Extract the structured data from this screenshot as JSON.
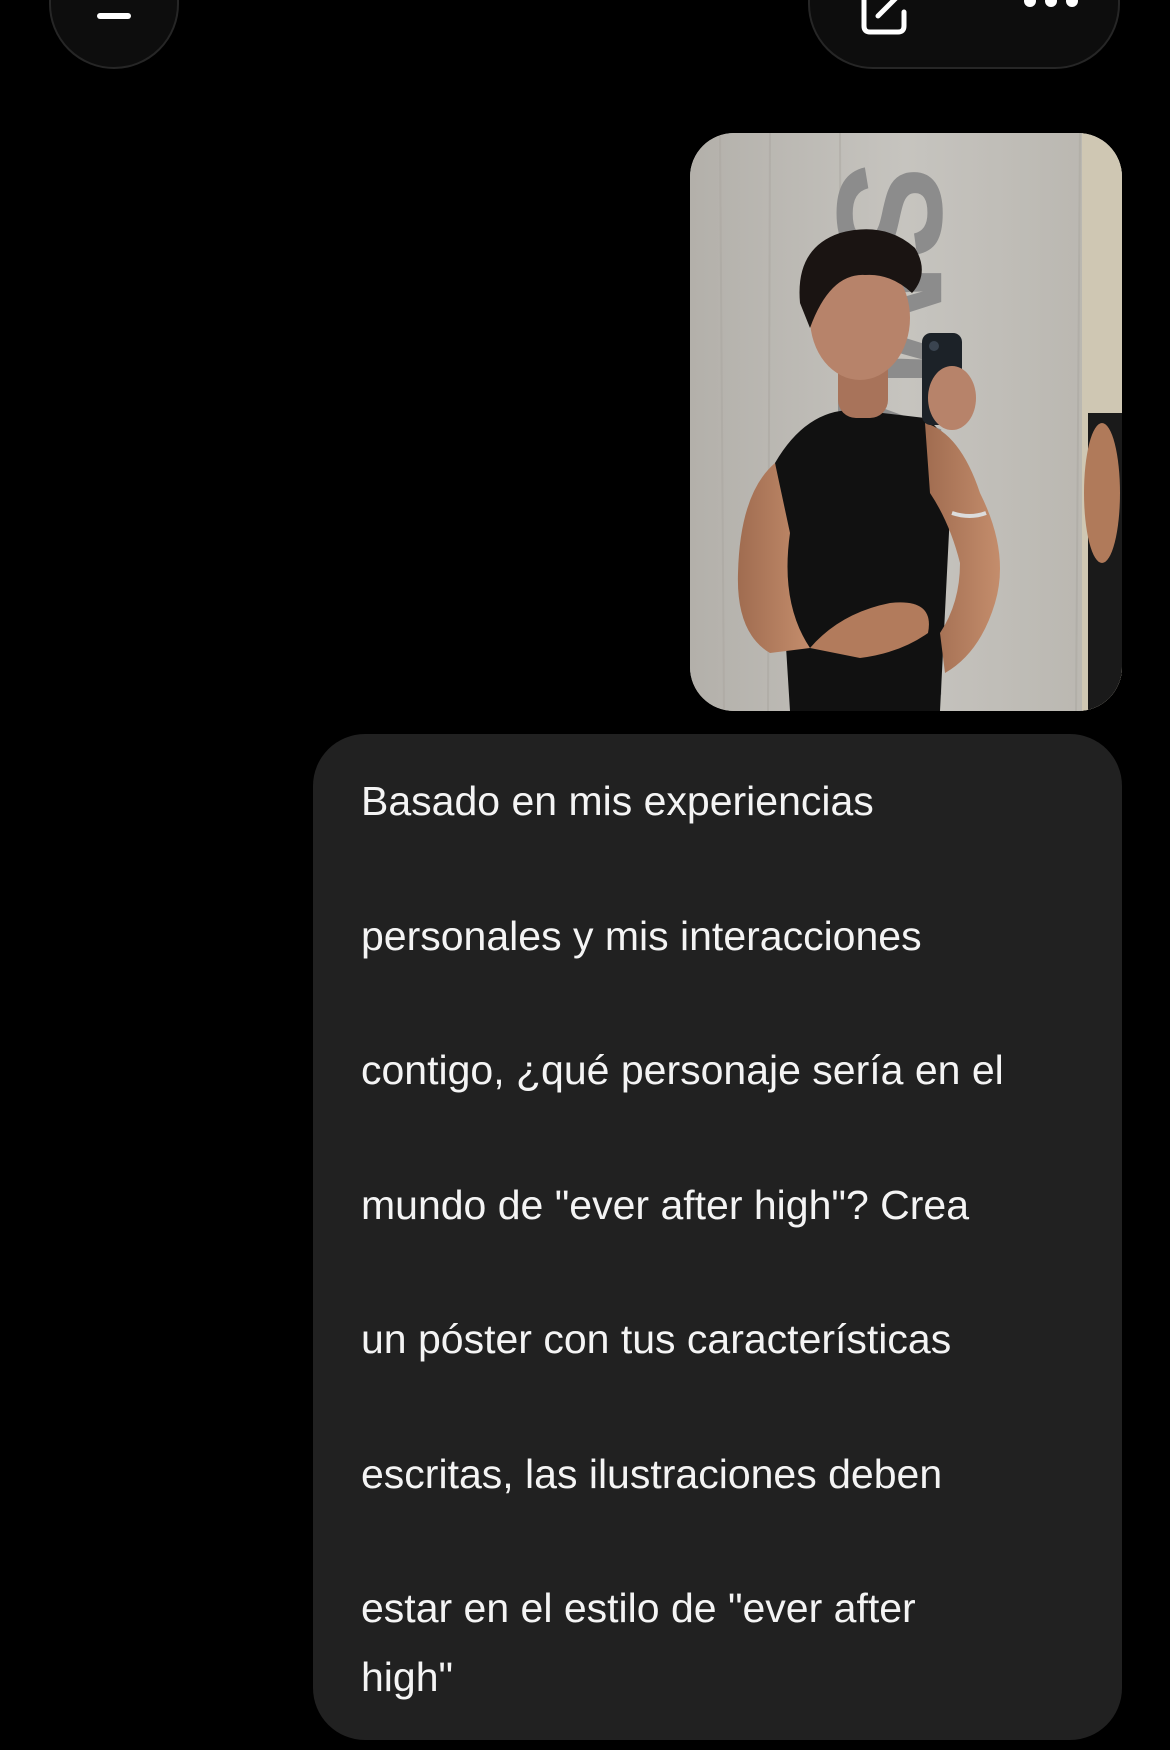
{
  "header": {
    "left_button_icon": "minus-icon",
    "edit_button_icon": "edit-icon",
    "more_button_icon": "more-dots-icon"
  },
  "sent_photo": {
    "lettering_on_curtain": "SMASH",
    "colors": {
      "curtain": "#bfbdb8",
      "lettering": "#8c8c8c",
      "shirt": "#111111",
      "skin": "#b98263",
      "hair": "#1a1412",
      "phone": "#1c2228"
    }
  },
  "message": {
    "lines": [
      "Basado en mis experiencias",
      "personales y mis interacciones",
      "contigo, ¿qué personaje sería en el",
      "mundo de \"ever after high\"? Crea",
      "un póster con tus características",
      "escritas, las ilustraciones deben",
      "estar en el estilo de \"ever after",
      "high\""
    ]
  },
  "colors": {
    "background": "#000000",
    "bubble": "#212121",
    "text": "#f4f4f4"
  }
}
